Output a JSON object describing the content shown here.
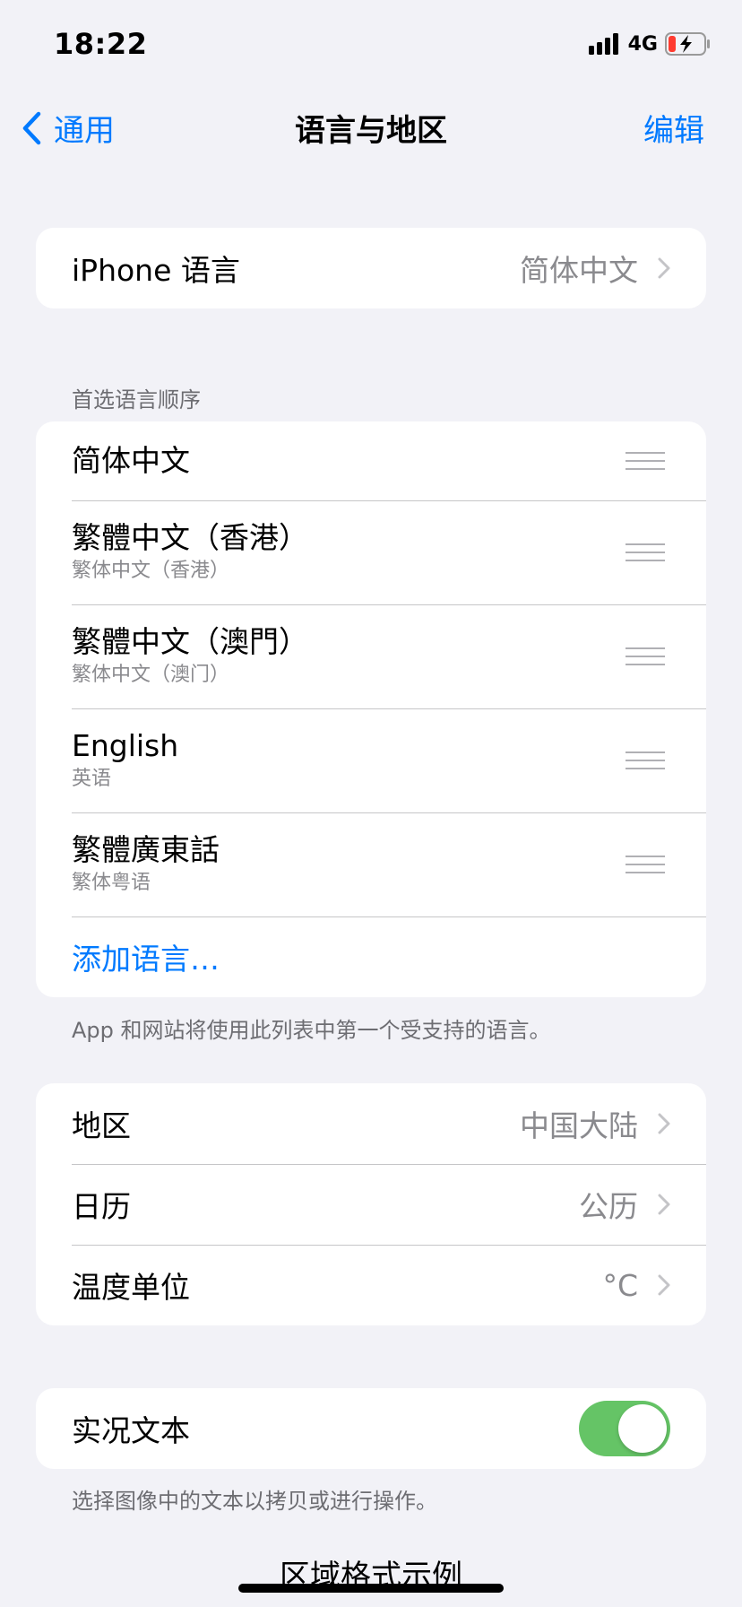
{
  "status_bar": {
    "time": "18:22",
    "network": "4G"
  },
  "nav": {
    "back_label": "通用",
    "title": "语言与地区",
    "edit_label": "编辑"
  },
  "iphone_language": {
    "label": "iPhone 语言",
    "value": "简体中文"
  },
  "preferred_languages": {
    "header": "首选语言顺序",
    "items": [
      {
        "primary": "简体中文",
        "secondary": ""
      },
      {
        "primary": "繁體中文（香港）",
        "secondary": "繁体中文（香港）"
      },
      {
        "primary": "繁體中文（澳門）",
        "secondary": "繁体中文（澳门）"
      },
      {
        "primary": "English",
        "secondary": "英语"
      },
      {
        "primary": "繁體廣東話",
        "secondary": "繁体粤语"
      }
    ],
    "add_label": "添加语言…",
    "footer": "App 和网站将使用此列表中第一个受支持的语言。"
  },
  "region_settings": {
    "items": [
      {
        "label": "地区",
        "value": "中国大陆"
      },
      {
        "label": "日历",
        "value": "公历"
      },
      {
        "label": "温度单位",
        "value": "°C"
      }
    ]
  },
  "live_text": {
    "label": "实况文本",
    "enabled": true,
    "footer": "选择图像中的文本以拷贝或进行操作。"
  },
  "format_example_title": "区域格式示例",
  "colors": {
    "accent": "#007aff",
    "toggle_on": "#65c466",
    "battery_low": "#ff3b30"
  }
}
